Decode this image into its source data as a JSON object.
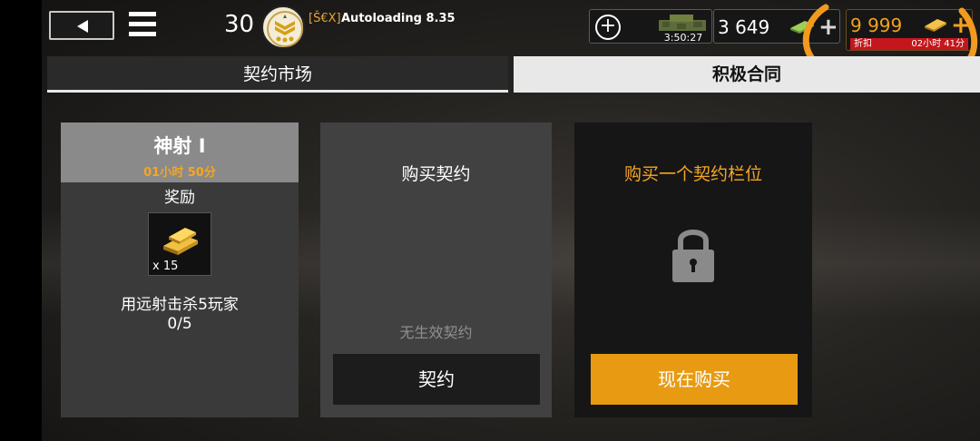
{
  "header": {
    "level": "30",
    "clan_tag": "[Š€X]",
    "player_name": "Autoloading 8.35",
    "tank_timer": "3:50:27",
    "cash_amount": "3 649",
    "gold_amount": "9 999",
    "discount_label": "折扣",
    "discount_timer": "02小时 41分"
  },
  "tabs": [
    {
      "label": "契约市场"
    },
    {
      "label": "积极合同"
    }
  ],
  "contract_card": {
    "title": "神射 I",
    "timer": "01小时 50分",
    "reward_label": "奖励",
    "reward_quantity": "x 15",
    "task": "用远射击杀5玩家",
    "progress": "0/5"
  },
  "empty_card": {
    "title": "购买契约",
    "status": "无生效契约",
    "button_label": "契约"
  },
  "slot_card": {
    "title": "购买一个契约栏位",
    "button_label": "现在购买"
  },
  "colors": {
    "accent": "#F5A623",
    "buy_button": "#E89B12",
    "discount": "#C4161C",
    "annotation": "#F39A1E"
  }
}
